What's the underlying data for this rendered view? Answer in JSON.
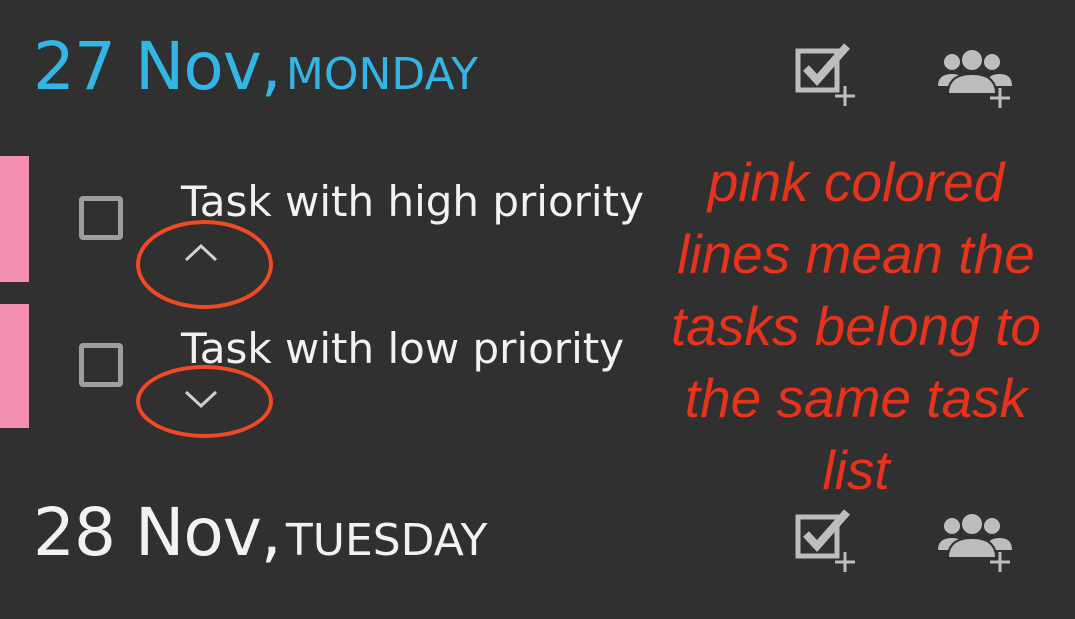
{
  "days": [
    {
      "date": "27 Nov,",
      "weekday": "MONDAY",
      "color": "#33b5e5",
      "actions": [
        "add-task-icon",
        "add-group-icon"
      ],
      "tasks": [
        {
          "title": "Task with high priority",
          "priority": "high",
          "priority_icon": "chevron-up-icon",
          "list_color": "#f48fb1",
          "checked": false
        },
        {
          "title": "Task with low priority",
          "priority": "low",
          "priority_icon": "chevron-down-icon",
          "list_color": "#f48fb1",
          "checked": false
        }
      ]
    },
    {
      "date": "28 Nov,",
      "weekday": "TUESDAY",
      "color": "#f2f2f2",
      "actions": [
        "add-task-icon",
        "add-group-icon"
      ]
    }
  ],
  "annotation": {
    "text": "pink colored lines mean the tasks belong to the same task list",
    "color": "#e5331d"
  },
  "colors": {
    "background": "#303030",
    "accent": "#33b5e5",
    "task_list": "#f48fb1",
    "annotation": "#f04a24"
  }
}
